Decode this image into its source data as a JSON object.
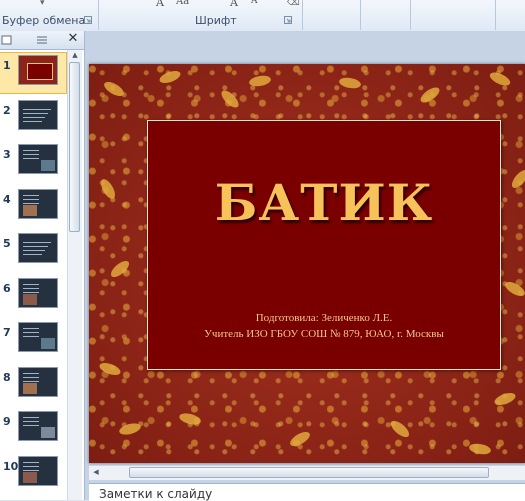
{
  "ribbon": {
    "group_clipboard": "Буфер обмена",
    "group_font": "Шрифт",
    "font_grow": "A",
    "font_case": "Aa",
    "font_shrink": "A",
    "font_tools": "A"
  },
  "slides_pane": {
    "close_symbol": "✕",
    "slides": [
      {
        "num": "1",
        "style": "batik"
      },
      {
        "num": "2",
        "style": "dark"
      },
      {
        "num": "3",
        "style": "dark-pic"
      },
      {
        "num": "4",
        "style": "dark-pic"
      },
      {
        "num": "5",
        "style": "dark"
      },
      {
        "num": "6",
        "style": "dark-pic"
      },
      {
        "num": "7",
        "style": "dark-pic"
      },
      {
        "num": "8",
        "style": "dark-pic"
      },
      {
        "num": "9",
        "style": "dark-pic"
      },
      {
        "num": "10",
        "style": "dark-pic"
      }
    ],
    "selected_index": 1
  },
  "slide": {
    "title": "БАТИК",
    "subtitle_line1": "Подготовила: Зеличенко Л.Е.",
    "subtitle_line2": "Учитель ИЗО ГБОУ СОШ № 879, ЮАО, г. Москвы"
  },
  "notes": {
    "placeholder": "Заметки к слайду"
  },
  "colors": {
    "title_gold": "#f6c259",
    "title_box": "#7a0000",
    "background_red": "#9c2c1c",
    "selection": "#fde8a8"
  }
}
